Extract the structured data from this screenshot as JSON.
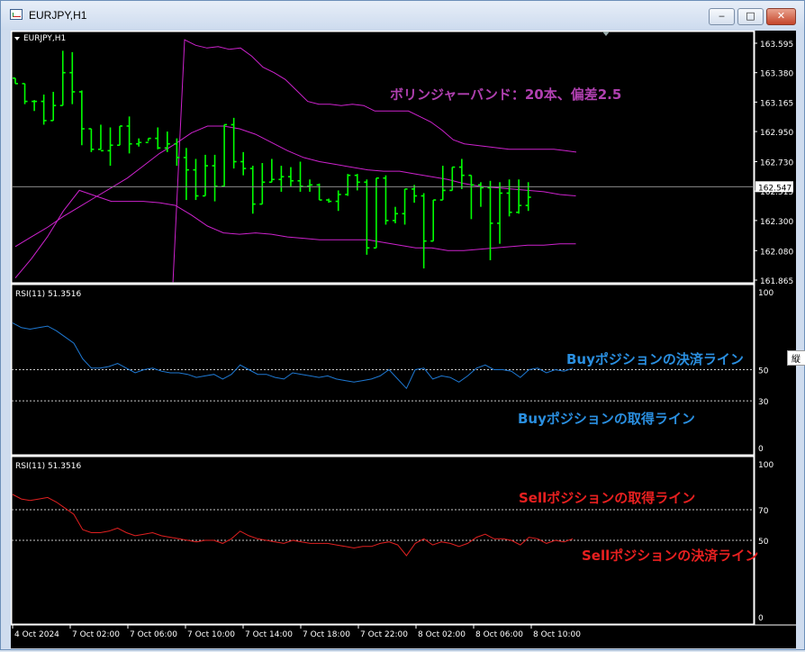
{
  "window": {
    "title": "EURJPY,H1",
    "buttons": {
      "minimize": "‒",
      "maximize": "□",
      "close": "✕"
    }
  },
  "side_tab": {
    "label": "縦"
  },
  "colors": {
    "background": "#000000",
    "candle": "#00ff00",
    "bollinger": "#cc22cc",
    "rsi_buy": "#1e78d2",
    "rsi_sell": "#e02020",
    "annotation_bands": "#b040b0",
    "annotation_buy": "#2a8fe0",
    "annotation_sell": "#e82020"
  },
  "chart_data": [
    {
      "type": "candlestick",
      "title": "EURJPY,H1",
      "ylim": [
        161.865,
        163.595
      ],
      "yticks": [
        "163.595",
        "163.380",
        "163.165",
        "162.950",
        "162.730",
        "162.515",
        "162.300",
        "162.080",
        "161.865"
      ],
      "current_price": "162.547",
      "annotation": "ボリンジャーバンド：20本、偏差2.5",
      "ohlc": [
        [
          163.34,
          163.34,
          163.3,
          163.3
        ],
        [
          163.3,
          163.3,
          163.15,
          163.17
        ],
        [
          163.17,
          163.18,
          163.1,
          163.17
        ],
        [
          163.17,
          163.22,
          163.0,
          163.03
        ],
        [
          163.03,
          163.24,
          163.03,
          163.14
        ],
        [
          163.14,
          163.54,
          163.14,
          163.38
        ],
        [
          163.38,
          163.53,
          163.15,
          163.24
        ],
        [
          163.24,
          163.25,
          162.85,
          162.97
        ],
        [
          162.97,
          162.97,
          162.8,
          162.82
        ],
        [
          162.82,
          163.0,
          162.82,
          162.81
        ],
        [
          162.81,
          162.98,
          162.7,
          162.85
        ],
        [
          162.85,
          162.99,
          162.85,
          162.99
        ],
        [
          162.99,
          163.06,
          162.79,
          162.86
        ],
        [
          162.86,
          162.9,
          162.84,
          162.87
        ],
        [
          162.87,
          162.9,
          162.88,
          162.9
        ],
        [
          162.9,
          162.98,
          162.82,
          162.83
        ],
        [
          162.83,
          162.95,
          162.8,
          162.86
        ],
        [
          162.86,
          162.9,
          162.7,
          162.76
        ],
        [
          162.76,
          162.83,
          162.45,
          162.67
        ],
        [
          162.67,
          162.75,
          162.45,
          162.48
        ],
        [
          162.48,
          162.78,
          162.48,
          162.7
        ],
        [
          162.7,
          162.78,
          162.44,
          162.55
        ],
        [
          162.55,
          163.0,
          162.55,
          163.0
        ],
        [
          163.0,
          163.05,
          162.68,
          162.73
        ],
        [
          162.73,
          162.8,
          162.63,
          162.68
        ],
        [
          162.68,
          162.7,
          162.35,
          162.42
        ],
        [
          162.42,
          162.72,
          162.42,
          162.58
        ],
        [
          162.58,
          162.75,
          162.58,
          162.6
        ],
        [
          162.6,
          162.7,
          162.51,
          162.62
        ],
        [
          162.62,
          162.69,
          162.55,
          162.59
        ],
        [
          162.59,
          162.73,
          162.51,
          162.55
        ],
        [
          162.55,
          162.6,
          162.51,
          162.56
        ],
        [
          162.56,
          162.57,
          162.45,
          162.45
        ],
        [
          162.45,
          162.46,
          162.43,
          162.44
        ],
        [
          162.44,
          162.52,
          162.37,
          162.49
        ],
        [
          162.49,
          162.64,
          162.48,
          162.63
        ],
        [
          162.63,
          162.64,
          162.52,
          162.58
        ],
        [
          162.58,
          162.6,
          162.05,
          162.1
        ],
        [
          162.1,
          162.61,
          162.1,
          162.61
        ],
        [
          162.61,
          162.63,
          162.27,
          162.3
        ],
        [
          162.3,
          162.4,
          162.28,
          162.35
        ],
        [
          162.35,
          162.53,
          162.27,
          162.53
        ],
        [
          162.53,
          162.56,
          162.43,
          162.48
        ],
        [
          162.48,
          162.5,
          161.95,
          162.15
        ],
        [
          162.15,
          162.45,
          162.15,
          162.45
        ],
        [
          162.45,
          162.7,
          162.45,
          162.52
        ],
        [
          162.52,
          162.69,
          162.52,
          162.69
        ],
        [
          162.69,
          162.75,
          162.53,
          162.63
        ],
        [
          162.63,
          162.63,
          162.31,
          162.56
        ],
        [
          162.56,
          162.58,
          162.4,
          162.54
        ],
        [
          162.54,
          162.59,
          162.01,
          162.28
        ],
        [
          162.28,
          162.58,
          162.13,
          162.5
        ],
        [
          162.5,
          162.6,
          162.33,
          162.36
        ],
        [
          162.36,
          162.6,
          162.35,
          162.41
        ],
        [
          162.41,
          162.58,
          162.37,
          162.47
        ]
      ],
      "bollinger": {
        "upper": [
          [
            11,
            163.62
          ],
          [
            12,
            163.58
          ],
          [
            13,
            163.56
          ],
          [
            14,
            163.57
          ],
          [
            15,
            163.55
          ],
          [
            16,
            163.56
          ],
          [
            17,
            163.5
          ],
          [
            18,
            163.42
          ],
          [
            19,
            163.38
          ],
          [
            20,
            163.33
          ],
          [
            21,
            163.25
          ],
          [
            22,
            163.17
          ],
          [
            23,
            163.15
          ],
          [
            24,
            163.15
          ],
          [
            25,
            163.14
          ],
          [
            26,
            163.15
          ],
          [
            27,
            163.14
          ],
          [
            28,
            163.1
          ],
          [
            29,
            163.1
          ],
          [
            30,
            163.1
          ],
          [
            31,
            163.1
          ],
          [
            32,
            163.06
          ],
          [
            33,
            163.02
          ],
          [
            34,
            162.96
          ],
          [
            35,
            162.89
          ],
          [
            36,
            162.86
          ],
          [
            37,
            162.85
          ],
          [
            38,
            162.84
          ],
          [
            39,
            162.83
          ],
          [
            40,
            162.82
          ],
          [
            41,
            162.82
          ],
          [
            42,
            162.82
          ],
          [
            43,
            162.82
          ],
          [
            44,
            162.82
          ],
          [
            45,
            162.81
          ],
          [
            46,
            162.8
          ]
        ],
        "middle": [
          [
            0,
            162.11
          ],
          [
            2,
            162.18
          ],
          [
            4,
            162.25
          ],
          [
            6,
            162.33
          ],
          [
            8,
            162.4
          ],
          [
            10,
            162.47
          ],
          [
            12,
            162.54
          ],
          [
            14,
            162.61
          ],
          [
            16,
            162.7
          ],
          [
            18,
            162.79
          ],
          [
            20,
            162.86
          ],
          [
            22,
            162.94
          ],
          [
            24,
            162.99
          ],
          [
            26,
            162.99
          ],
          [
            28,
            162.97
          ],
          [
            30,
            162.93
          ],
          [
            32,
            162.87
          ],
          [
            34,
            162.81
          ],
          [
            36,
            162.76
          ],
          [
            38,
            162.73
          ],
          [
            40,
            162.71
          ],
          [
            42,
            162.69
          ],
          [
            44,
            162.67
          ],
          [
            46,
            162.66
          ],
          [
            48,
            162.66
          ],
          [
            50,
            162.64
          ],
          [
            52,
            162.62
          ],
          [
            54,
            162.6
          ],
          [
            56,
            162.57
          ],
          [
            58,
            162.55
          ],
          [
            60,
            162.54
          ],
          [
            62,
            162.53
          ],
          [
            64,
            162.52
          ],
          [
            66,
            162.51
          ],
          [
            68,
            162.49
          ],
          [
            70,
            162.48
          ]
        ],
        "lower": [
          [
            0,
            161.88
          ],
          [
            2,
            162.02
          ],
          [
            4,
            162.18
          ],
          [
            6,
            162.37
          ],
          [
            8,
            162.52
          ],
          [
            10,
            162.48
          ],
          [
            12,
            162.44
          ],
          [
            14,
            162.44
          ],
          [
            16,
            162.44
          ],
          [
            18,
            162.43
          ],
          [
            20,
            162.41
          ],
          [
            22,
            162.34
          ],
          [
            24,
            162.26
          ],
          [
            26,
            162.21
          ],
          [
            28,
            162.2
          ],
          [
            30,
            162.21
          ],
          [
            32,
            162.2
          ],
          [
            34,
            162.18
          ],
          [
            36,
            162.17
          ],
          [
            38,
            162.16
          ],
          [
            40,
            162.16
          ],
          [
            42,
            162.16
          ],
          [
            44,
            162.16
          ],
          [
            46,
            162.14
          ],
          [
            48,
            162.12
          ],
          [
            50,
            162.1
          ],
          [
            52,
            162.1
          ],
          [
            54,
            162.08
          ],
          [
            56,
            162.08
          ],
          [
            58,
            162.09
          ],
          [
            60,
            162.1
          ],
          [
            62,
            162.11
          ],
          [
            64,
            162.12
          ],
          [
            66,
            162.12
          ],
          [
            68,
            162.13
          ],
          [
            70,
            162.13
          ]
        ]
      },
      "bollinger_visible_x": [
        13,
        55
      ]
    },
    {
      "type": "line",
      "title": "RSI(11) 51.3516",
      "annotation_upper": "Buyポジションの決済ライン",
      "annotation_lower": "Buyポジションの取得ライン",
      "ylim": [
        0,
        100
      ],
      "yticks": [
        "100",
        "50",
        "30",
        "0"
      ],
      "levels": [
        50,
        30
      ],
      "values": [
        80,
        77,
        76,
        77,
        78,
        75,
        71,
        67,
        57,
        51,
        51,
        52,
        54,
        51,
        48,
        50,
        51,
        49,
        48,
        48,
        47,
        45,
        46,
        47,
        44,
        47,
        53,
        50,
        47,
        47,
        45,
        44,
        48,
        47,
        46,
        45,
        46,
        44,
        43,
        42,
        43,
        44,
        46,
        50,
        44,
        38,
        50,
        51,
        44,
        46,
        45,
        42,
        46,
        51,
        53,
        50,
        50,
        49,
        45,
        50,
        51,
        48,
        50,
        49,
        51
      ]
    },
    {
      "type": "line",
      "title": "RSI(11) 51.3516",
      "annotation_upper": "Sellポジションの取得ライン",
      "annotation_lower": "Sellポジションの決済ライン",
      "ylim": [
        0,
        100
      ],
      "yticks": [
        "100",
        "70",
        "50",
        "0"
      ],
      "levels": [
        70,
        50
      ],
      "values": [
        80,
        77,
        76,
        77,
        78,
        75,
        71,
        67,
        57,
        55,
        55,
        56,
        58,
        55,
        53,
        54,
        55,
        53,
        52,
        51,
        50,
        49,
        50,
        50,
        48,
        51,
        56,
        53,
        51,
        50,
        49,
        48,
        50,
        49,
        48,
        48,
        48,
        47,
        46,
        45,
        46,
        46,
        48,
        49,
        47,
        40,
        48,
        51,
        47,
        49,
        48,
        46,
        48,
        52,
        54,
        51,
        51,
        50,
        47,
        52,
        51,
        48,
        50,
        49,
        51
      ]
    }
  ],
  "time_axis": [
    "4 Oct 2024",
    "7 Oct 02:00",
    "7 Oct 06:00",
    "7 Oct 10:00",
    "7 Oct 14:00",
    "7 Oct 18:00",
    "7 Oct 22:00",
    "8 Oct 02:00",
    "8 Oct 06:00",
    "8 Oct 10:00"
  ]
}
